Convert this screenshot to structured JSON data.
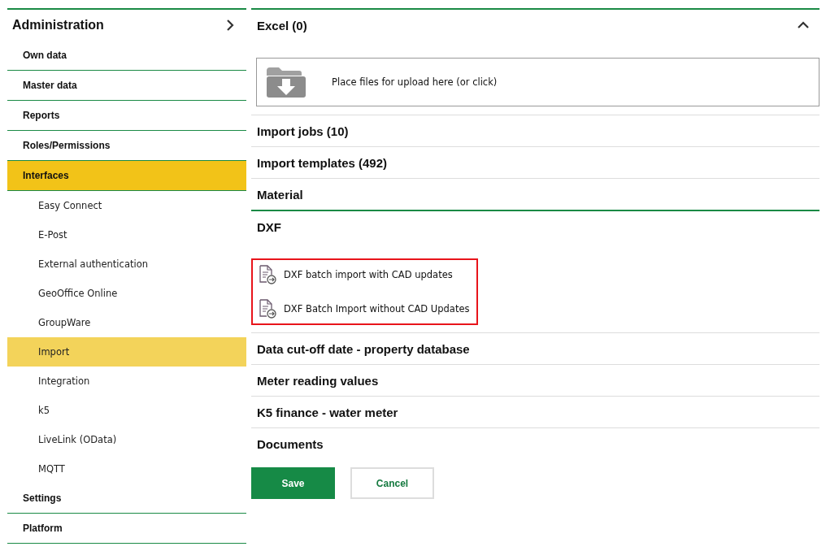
{
  "sidebar": {
    "title": "Administration",
    "items": [
      {
        "label": "Own data",
        "selected": false
      },
      {
        "label": "Master data",
        "selected": false
      },
      {
        "label": "Reports",
        "selected": false
      },
      {
        "label": "Roles/Permissions",
        "selected": false
      },
      {
        "label": "Interfaces",
        "selected": true,
        "children": [
          {
            "label": "Easy Connect",
            "selected": false
          },
          {
            "label": "E-Post",
            "selected": false
          },
          {
            "label": "External authentication",
            "selected": false
          },
          {
            "label": "GeoOffice Online",
            "selected": false
          },
          {
            "label": "GroupWare",
            "selected": false
          },
          {
            "label": "Import",
            "selected": true
          },
          {
            "label": "Integration",
            "selected": false
          },
          {
            "label": "k5",
            "selected": false
          },
          {
            "label": "LiveLink (OData)",
            "selected": false
          },
          {
            "label": "MQTT",
            "selected": false
          }
        ]
      },
      {
        "label": "Settings",
        "selected": false
      },
      {
        "label": "Platform",
        "selected": false
      }
    ]
  },
  "sections": [
    {
      "title": "Excel (0)",
      "expanded": true,
      "show_toggle": true,
      "upload": {
        "text": "Place files for upload here (or click)"
      }
    },
    {
      "title": "Import jobs (10)",
      "expanded": false,
      "show_toggle": false
    },
    {
      "title": "Import templates (492)",
      "expanded": false,
      "show_toggle": false
    },
    {
      "title": "Material",
      "expanded": false,
      "show_toggle": false
    },
    {
      "title": "DXF",
      "expanded": true,
      "show_toggle": false,
      "highlighted": true,
      "links": [
        "DXF batch import with CAD updates",
        "DXF Batch Import without CAD Updates"
      ]
    },
    {
      "title": "Data cut-off date - property database",
      "expanded": false,
      "show_toggle": false
    },
    {
      "title": "Meter reading values",
      "expanded": false,
      "show_toggle": false
    },
    {
      "title": "K5 finance - water meter",
      "expanded": false,
      "show_toggle": false
    },
    {
      "title": "Documents",
      "expanded": false,
      "show_toggle": false
    }
  ],
  "buttons": {
    "save": "Save",
    "cancel": "Cancel"
  }
}
